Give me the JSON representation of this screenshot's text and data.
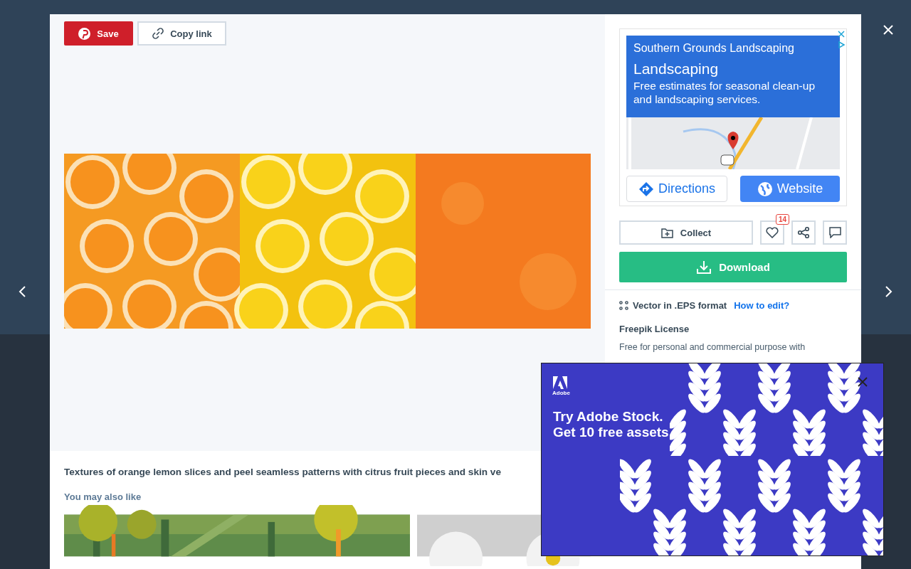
{
  "toolbar": {
    "save": "Save",
    "copy_link": "Copy link"
  },
  "description": "Textures of orange lemon slices and peel seamless patterns with citrus fruit pieces and skin ve",
  "related": {
    "heading": "You may also like"
  },
  "google_ad": {
    "advertiser": "Southern Grounds Landscaping",
    "headline": "Landscaping",
    "body": "Free estimates for seasonal clean-up and landscaping services.",
    "directions": "Directions",
    "website": "Website"
  },
  "actions": {
    "collect": "Collect",
    "likes": "14",
    "download": "Download"
  },
  "format": {
    "label": "Vector in .EPS format",
    "link": "How to edit?"
  },
  "license": {
    "title": "Freepik License",
    "text": "Free for personal and commercial purpose with"
  },
  "popup_ad": {
    "brand": "Adobe",
    "lines": [
      "Try Adobe Stock.",
      "Get 10 free assets."
    ]
  }
}
